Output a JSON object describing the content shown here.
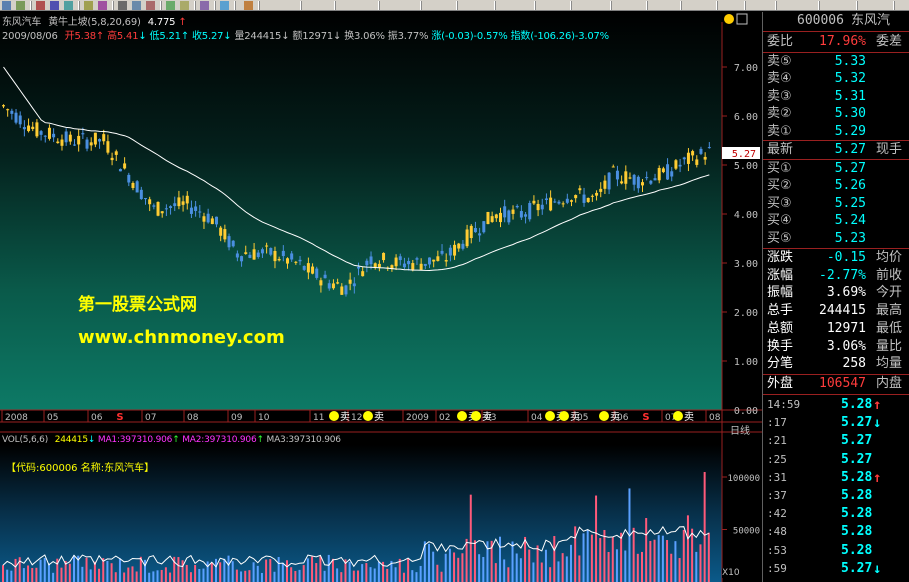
{
  "header": {
    "stock_name": "东风汽车",
    "indicator": "黄牛上坡(5,8,20,69)",
    "indicator_value": "4.775",
    "indicator_arrow": "↑",
    "date": "2009/08/06",
    "open_label": "开",
    "open": "5.38",
    "high_label": "高",
    "high": "5.41",
    "low_label": "低",
    "low": "5.21",
    "close_label": "收",
    "close": "5.27",
    "vol_label": "量",
    "vol": "244415",
    "amount_label": "额",
    "amount": "12971",
    "turnover_label": "换",
    "turnover": "3.06%",
    "amplitude_label": "振",
    "amplitude": "3.77%",
    "change_text": "涨(-0.03)-0.57%",
    "index_text": "指数(-106.26)-3.07%"
  },
  "overlay": {
    "site_cn": "第一股票公式网",
    "site_url": "www.chnmoney.com"
  },
  "price_axis": {
    "labels": [
      "7.00",
      "6.00",
      "5.00",
      "4.00",
      "3.00",
      "2.00",
      "1.00",
      "0.00"
    ],
    "current_price": "5.27"
  },
  "date_axis": {
    "labels": [
      "2008",
      "05",
      "06",
      "07",
      "08",
      "09",
      "10",
      "11",
      "12",
      "2009",
      "02",
      "03",
      "04",
      "05",
      "06",
      "07",
      "08"
    ],
    "period": "日线"
  },
  "signals": {
    "sell_label": "卖",
    "s_label": "S"
  },
  "volume": {
    "header_name": "VOL(5,6,6)",
    "value": "244415",
    "ma1_label": "MA1:",
    "ma1": "397310.906",
    "ma2_label": "MA2:",
    "ma2": "397310.906",
    "ma3_label": "MA3:",
    "ma3": "397310.906",
    "code_text": "【代码:600006 名称:东风汽车】",
    "axis_labels": [
      "100000",
      "50000"
    ],
    "unit_label": "X10"
  },
  "quote_panel": {
    "code": "600006",
    "name": "东风汽",
    "webi_label": "委比",
    "webi": "17.96%",
    "weicha_label": "委差",
    "asks": [
      {
        "label": "卖⑤",
        "price": "5.33"
      },
      {
        "label": "卖④",
        "price": "5.32"
      },
      {
        "label": "卖③",
        "price": "5.31"
      },
      {
        "label": "卖②",
        "price": "5.30"
      },
      {
        "label": "卖①",
        "price": "5.29"
      }
    ],
    "latest_label": "最新",
    "latest": "5.27",
    "current_hand_label": "现手",
    "bids": [
      {
        "label": "买①",
        "price": "5.27"
      },
      {
        "label": "买②",
        "price": "5.26"
      },
      {
        "label": "买③",
        "price": "5.25"
      },
      {
        "label": "买④",
        "price": "5.24"
      },
      {
        "label": "买⑤",
        "price": "5.23"
      }
    ],
    "stats": [
      {
        "label": "涨跌",
        "value": "-0.15",
        "label2": "均价",
        "color": "cyan"
      },
      {
        "label": "涨幅",
        "value": "-2.77%",
        "label2": "前收",
        "color": "cyan"
      },
      {
        "label": "振幅",
        "value": "3.69%",
        "label2": "今开",
        "color": "white"
      },
      {
        "label": "总手",
        "value": "244415",
        "label2": "最高",
        "color": "white"
      },
      {
        "label": "总额",
        "value": "12971",
        "label2": "最低",
        "color": "white"
      },
      {
        "label": "换手",
        "value": "3.06%",
        "label2": "量比",
        "color": "white"
      },
      {
        "label": "分笔",
        "value": "258",
        "label2": "均量",
        "color": "white"
      }
    ],
    "outer_label": "外盘",
    "outer": "106547",
    "inner_label": "内盘",
    "ticks": [
      {
        "time": "14:59",
        "price": "5.28",
        "arrow": "↑",
        "dir": "up"
      },
      {
        "time": ":17",
        "price": "5.27",
        "arrow": "↓",
        "dir": "down"
      },
      {
        "time": ":21",
        "price": "5.27",
        "arrow": "",
        "dir": "none"
      },
      {
        "time": ":25",
        "price": "5.27",
        "arrow": "",
        "dir": "none"
      },
      {
        "time": ":31",
        "price": "5.28",
        "arrow": "↑",
        "dir": "up"
      },
      {
        "time": ":37",
        "price": "5.28",
        "arrow": "",
        "dir": "none"
      },
      {
        "time": ":42",
        "price": "5.28",
        "arrow": "",
        "dir": "none"
      },
      {
        "time": ":48",
        "price": "5.28",
        "arrow": "",
        "dir": "none"
      },
      {
        "time": ":53",
        "price": "5.28",
        "arrow": "",
        "dir": "none"
      },
      {
        "time": ":59",
        "price": "5.27",
        "arrow": "↓",
        "dir": "down"
      }
    ]
  },
  "colors": {
    "up": "#ff3c3c",
    "down": "#00ffff",
    "candle_up": "#ffcc33",
    "candle_down": "#4a8fe0",
    "ma_line": "#ffffff",
    "accent_yellow": "#ffff00",
    "magenta": "#ff33ff",
    "green": "#33ff33"
  }
}
